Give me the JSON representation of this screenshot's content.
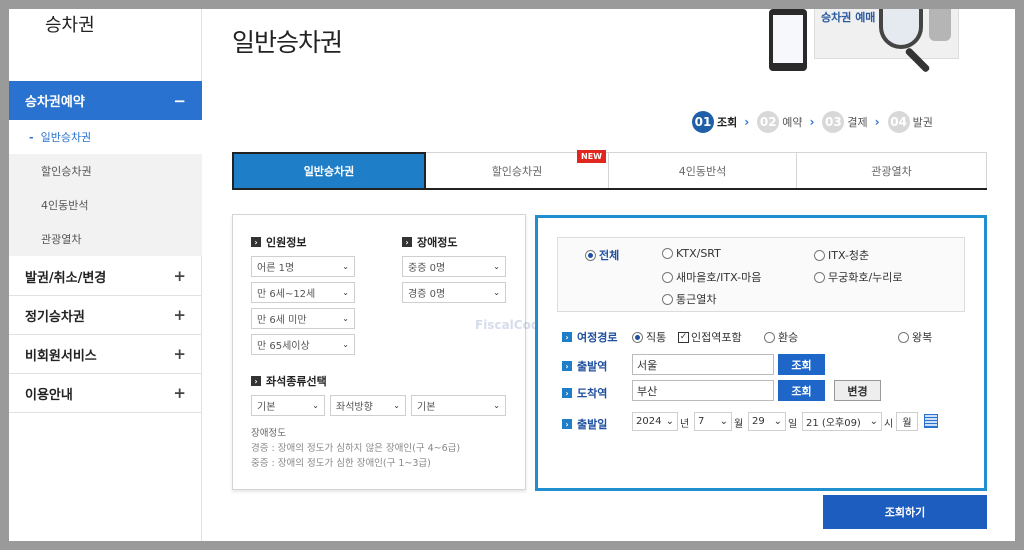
{
  "sidebar": {
    "title": "승차권",
    "active_item": {
      "label": "승차권예약",
      "toggle": "−"
    },
    "sub_items": [
      {
        "label": "일반승차권",
        "current": true
      },
      {
        "label": "할인승차권"
      },
      {
        "label": "4인동반석"
      },
      {
        "label": "관광열차"
      }
    ],
    "items": [
      {
        "label": "발권/취소/변경",
        "toggle": "+"
      },
      {
        "label": "정기승차권",
        "toggle": "+"
      },
      {
        "label": "비회원서비스",
        "toggle": "+"
      },
      {
        "label": "이용안내",
        "toggle": "+"
      }
    ]
  },
  "header": {
    "title": "일반승차권",
    "banner_text": "승차권 예매"
  },
  "steps": [
    {
      "num": "01",
      "label": "조회",
      "active": true
    },
    {
      "num": "02",
      "label": "예약"
    },
    {
      "num": "03",
      "label": "결제"
    },
    {
      "num": "04",
      "label": "발권"
    }
  ],
  "tabs": [
    {
      "label": "일반승차권",
      "active": true
    },
    {
      "label": "할인승차권",
      "badge": "NEW"
    },
    {
      "label": "4인동반석"
    },
    {
      "label": "관광열차"
    }
  ],
  "passenger": {
    "heading": "인원정보",
    "selects": [
      "어른 1명",
      "만 6세~12세",
      "만 6세 미만",
      "만 65세이상"
    ]
  },
  "disability": {
    "heading": "장애정도",
    "selects": [
      "중증 0명",
      "경증 0명"
    ]
  },
  "seat": {
    "heading": "좌석종류선택",
    "selects": [
      "기본",
      "좌석방향",
      "기본"
    ]
  },
  "notes": {
    "title": "장애정도",
    "line1": "경증 : 장애의 정도가 심하지 않은 장애인(구 4~6급)",
    "line2": "중증 : 장애의 정도가 심한 장애인(구 1~3급)"
  },
  "train_types": [
    {
      "label": "전체",
      "selected": true
    },
    {
      "label": "KTX/SRT"
    },
    {
      "label": "ITX-청춘"
    },
    {
      "label": "새마을호/ITX-마음"
    },
    {
      "label": "무궁화호/누리로"
    },
    {
      "label": "통근열차"
    }
  ],
  "route": {
    "label": "여정경로",
    "options": {
      "direct": "직통",
      "include_connecting": "인접역포함",
      "transfer": "환승",
      "roundtrip": "왕복"
    }
  },
  "departure": {
    "label": "출발역",
    "value": "서울",
    "search": "조회"
  },
  "arrival": {
    "label": "도착역",
    "value": "부산",
    "search": "조회",
    "swap": "변경"
  },
  "date": {
    "label": "출발일",
    "year": "2024",
    "year_unit": "년",
    "month": "7",
    "month_unit": "월",
    "day": "29",
    "day_unit": "일",
    "hour": "21 (오후09)",
    "hour_unit": "시",
    "weekday": "월"
  },
  "submit_label": "조회하기",
  "watermark": "FiscalCode"
}
